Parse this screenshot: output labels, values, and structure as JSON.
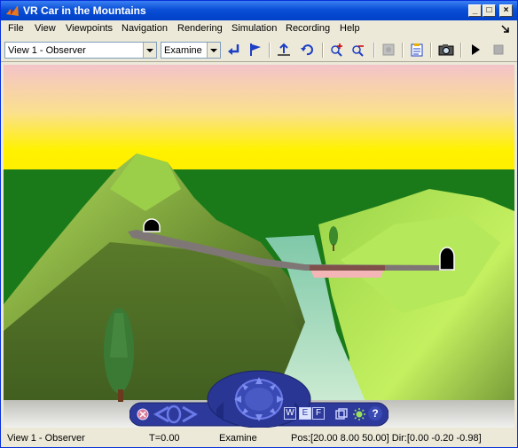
{
  "window": {
    "title": "VR Car in the Mountains"
  },
  "menu": [
    "File",
    "View",
    "Viewpoints",
    "Navigation",
    "Rendering",
    "Simulation",
    "Recording",
    "Help"
  ],
  "toolbar": {
    "viewpoint_value": "View 1 - Observer",
    "nav_mode_value": "Examine"
  },
  "nav_panel": {
    "w_label": "W",
    "e_label": "E",
    "f_label": "F",
    "help_label": "?"
  },
  "status": {
    "viewpoint": "View 1 - Observer",
    "time": "T=0.00",
    "mode": "Examine",
    "position": "Pos:[20.00 8.00 50.00] Dir:[0.00 -0.20 -0.98]"
  },
  "colors": {
    "title_bar": "#0a4fd6",
    "sky_top": "#f3c3c9",
    "sky_bottom": "#ffee00",
    "ground": "#1a7a1a",
    "nav_panel": "#2d3a9c"
  }
}
